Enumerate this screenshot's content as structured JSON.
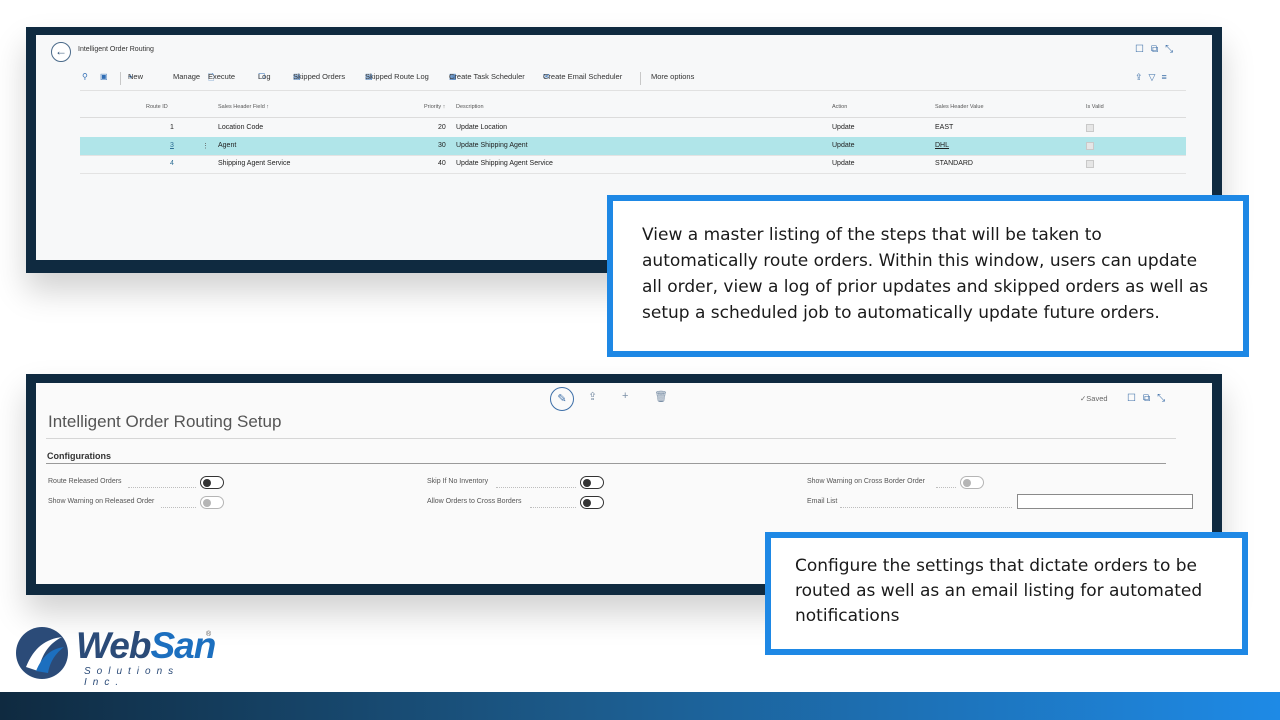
{
  "list_window": {
    "title": "Intelligent Order Routing",
    "toolbar": {
      "new": "New",
      "manage": "Manage",
      "execute": "Execute",
      "log": "Log",
      "skipped_orders": "Skipped Orders",
      "skipped_route_log": "Skipped Route Log",
      "create_task_scheduler": "Create Task Scheduler",
      "create_email_scheduler": "Create Email Scheduler",
      "more_options": "More options"
    },
    "columns": {
      "route_id": "Route ID",
      "sales_header_field": "Sales Header Field ↑",
      "priority": "Priority ↑",
      "description": "Description",
      "action": "Action",
      "sales_header_value": "Sales Header Value",
      "is_valid": "Is Valid"
    },
    "rows": [
      {
        "route_id": "1",
        "field": "Location Code",
        "priority": "20",
        "description": "Update Location",
        "action": "Update",
        "value": "EAST"
      },
      {
        "route_id": "3",
        "field": "Agent",
        "priority": "30",
        "description": "Update Shipping Agent",
        "action": "Update",
        "value": "DHL"
      },
      {
        "route_id": "4",
        "field": "Shipping Agent Service",
        "priority": "40",
        "description": "Update Shipping Agent Service",
        "action": "Update",
        "value": "STANDARD"
      }
    ]
  },
  "callout1": "View a master listing of the steps that will be taken to automatically route orders.  Within this window, users can update all order, view a log of prior updates and skipped orders as well as setup a scheduled job to automatically update future orders.",
  "setup_window": {
    "saved": "✓Saved",
    "title": "Intelligent Order Routing Setup",
    "section": "Configurations",
    "fields": {
      "route_released_orders": "Route Released Orders",
      "show_warning_released": "Show Warning on Released Order",
      "skip_if_no_inventory": "Skip If No Inventory",
      "allow_cross_borders": "Allow Orders to Cross Borders",
      "show_warning_cross_border": "Show Warning on Cross Border Order",
      "email_list": "Email List"
    },
    "toggles": {
      "route_released_orders": false,
      "show_warning_released": false,
      "skip_if_no_inventory": false,
      "allow_cross_borders": false,
      "show_warning_cross_border": false
    },
    "email_list_value": ""
  },
  "callout2": "Configure the settings that dictate orders to be routed as well as an email listing for automated notifications",
  "logo": {
    "word_part1": "Web",
    "word_part2": "San",
    "registered": "®",
    "subtitle": "Solutions Inc."
  },
  "colors": {
    "frame": "#0f2a40",
    "accent": "#1e88e5",
    "selected_row": "#b0e5e9",
    "brand_blue": "#1c6fbf",
    "brand_navy": "#2b4b78"
  }
}
